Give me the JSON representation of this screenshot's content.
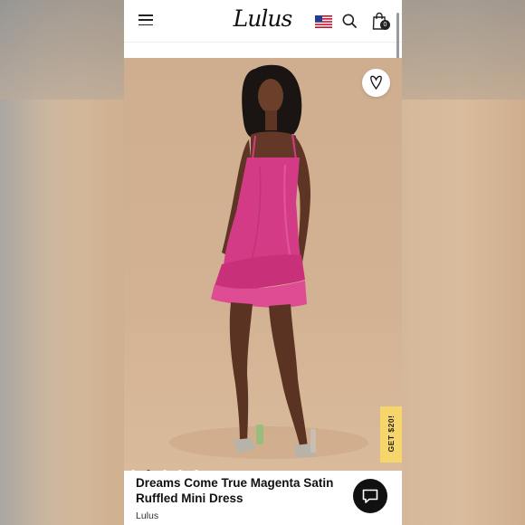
{
  "header": {
    "logo_text": "Lulus",
    "cart_count": "0"
  },
  "hero": {
    "promo_label": "GET $20!",
    "dots_count": 5,
    "active_dot": 1
  },
  "product": {
    "title": "Dreams Come True Magenta Satin Ruffled Mini Dress",
    "brand": "Lulus"
  },
  "colors": {
    "dress": "#d43b86",
    "promo": "#f6d66b",
    "chat": "#111111"
  }
}
